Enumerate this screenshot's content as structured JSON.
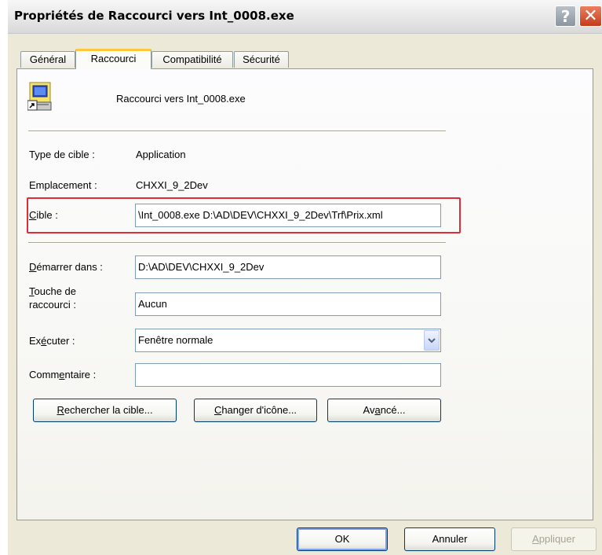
{
  "window": {
    "title": "Propriétés de Raccourci vers Int_0008.exe",
    "help_glyph": "?",
    "close_glyph": "✕"
  },
  "tabs": [
    {
      "label": "Général",
      "active": false
    },
    {
      "label": "Raccourci",
      "active": true
    },
    {
      "label": "Compatibilité",
      "active": false
    },
    {
      "label": "Sécurité",
      "active": false
    }
  ],
  "header": {
    "icon": "exe-shortcut-icon",
    "shortcut_name": "Raccourci vers Int_0008.exe"
  },
  "fields": {
    "target_type_label": "Type de cible :",
    "target_type_value": "Application",
    "location_label": "Emplacement :",
    "location_value": "CHXXI_9_2Dev",
    "target_label_accel": "C",
    "target_label_rest": "ible :",
    "target_value": "\\Int_0008.exe D:\\AD\\DEV\\CHXXI_9_2Dev\\Trf\\Prix.xml",
    "start_in_label_accel": "D",
    "start_in_label_rest": "émarrer dans :",
    "start_in_value": "D:\\AD\\DEV\\CHXXI_9_2Dev",
    "shortcut_key_label_accel": "T",
    "shortcut_key_label_rest1": "ouche de",
    "shortcut_key_label_line2": "raccourci :",
    "shortcut_key_value": "Aucun",
    "run_label_pre": "Ex",
    "run_label_accel": "é",
    "run_label_rest": "cuter :",
    "run_value": "Fenêtre normale",
    "comment_label_pre": "Comm",
    "comment_label_accel": "e",
    "comment_label_rest": "ntaire :",
    "comment_value": ""
  },
  "buttons": {
    "find_target_accel": "R",
    "find_target_rest": "echercher la cible...",
    "change_icon_accel": "C",
    "change_icon_rest": "hanger d'icône...",
    "advanced_pre": "Av",
    "advanced_accel": "a",
    "advanced_rest": "ncé...",
    "ok": "OK",
    "cancel": "Annuler",
    "apply_accel": "A",
    "apply_rest": "ppliquer"
  },
  "colors": {
    "highlight_box": "#e02b38",
    "tab_accent": "#ffc83c",
    "dialog_bg": "#ece9d8"
  }
}
